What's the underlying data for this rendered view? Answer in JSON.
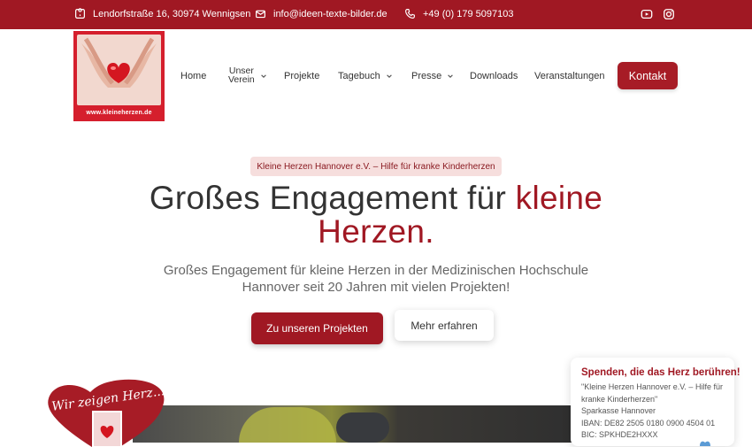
{
  "topbar": {
    "address": "Lendorfstraße 16, 30974 Wennigsen",
    "email": "info@ideen-texte-bilder.de",
    "phone": "+49 (0) 179 5097103",
    "icons": [
      "map-icon",
      "mail-icon",
      "phone-icon",
      "youtube-icon",
      "instagram-icon"
    ]
  },
  "logo": {
    "text": "www.kleineherzen.de"
  },
  "nav": {
    "items": [
      {
        "label": "Home"
      },
      {
        "label": "Unser Verein"
      },
      {
        "label": "Projekte"
      },
      {
        "label": "Tagebuch"
      },
      {
        "label": "Presse"
      },
      {
        "label": "Downloads"
      },
      {
        "label": "Veranstaltungen"
      }
    ],
    "unser_line1": "Unser",
    "unser_line2": "Verein",
    "cta": "Kontakt"
  },
  "hero": {
    "badge": "Kleine Herzen Hannover e.V. – Hilfe für kranke Kinderherzen",
    "title_main": "Großes Engagement für ",
    "title_accent_1": "kleine",
    "title_accent_2": "Herzen.",
    "subtitle": "Großes Engagement für kleine Herzen in der Medizinischen Hochschule Hannover seit 20 Jahren mit vielen Projekten!",
    "primary_button": "Zu unseren Projekten",
    "secondary_button": "Mehr erfahren"
  },
  "sticker": {
    "text": "Wir zeigen Herz..."
  },
  "donate": {
    "title": "Spenden, die das Herz berühren!",
    "line1": "\"Kleine Herzen Hannover e.V. – Hilfe für kranke Kinderherzen\"",
    "line2": "Sparkasse Hannover",
    "line3": "IBAN: DE82 2505 0180 0900 4504 01",
    "line4": "BIC: SPKHDE2HXXX"
  },
  "colors": {
    "brand": "#a01823",
    "badge_bg": "#f6dedd",
    "text": "#333333"
  }
}
